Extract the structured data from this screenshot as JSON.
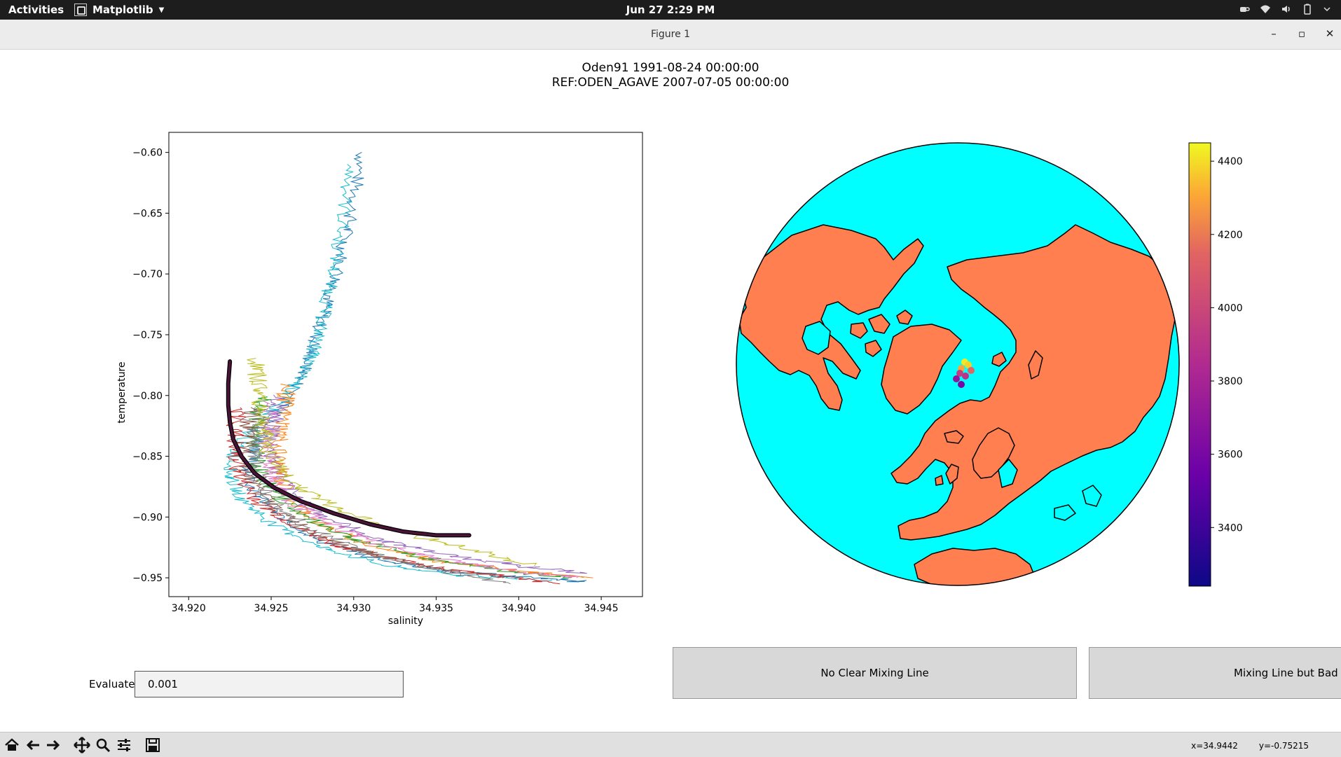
{
  "topbar": {
    "activities": "Activities",
    "app_name": "Matplotlib",
    "clock": "Jun 27  2:29 PM",
    "status_icons": [
      "coffee-icon",
      "wifi-icon",
      "volume-icon",
      "battery-icon",
      "power-menu-icon"
    ]
  },
  "window": {
    "title": "Figure 1",
    "minimize": "–",
    "maximize": "▫",
    "close": "✕"
  },
  "figure": {
    "title_line1": "Oden91 1991-08-24 00:00:00",
    "title_line2": "REF:ODEN_AGAVE 2007-07-05 00:00:00"
  },
  "chart_data": [
    {
      "type": "line",
      "xlabel": "salinity",
      "ylabel": "temperature",
      "xlim": [
        34.9188,
        34.9475
      ],
      "ylim": [
        -0.9655,
        -0.5835
      ],
      "xticks": [
        "34.920",
        "34.925",
        "34.930",
        "34.935",
        "34.940",
        "34.945"
      ],
      "xtick_values": [
        34.92,
        34.925,
        34.93,
        34.935,
        34.94,
        34.945
      ],
      "yticks": [
        "−0.60",
        "−0.65",
        "−0.70",
        "−0.75",
        "−0.80",
        "−0.85",
        "−0.90",
        "−0.95"
      ],
      "ytick_values": [
        -0.6,
        -0.65,
        -0.7,
        -0.75,
        -0.8,
        -0.85,
        -0.9,
        -0.95
      ],
      "grid": false,
      "series": [
        {
          "color": "#1f77b4",
          "x": [
            34.9305,
            34.93,
            34.9295,
            34.929,
            34.9285,
            34.928,
            34.9275,
            34.927,
            34.9262,
            34.9252,
            34.9242,
            34.9236,
            34.924,
            34.9255,
            34.928,
            34.9315,
            34.936,
            34.941,
            34.944
          ],
          "y": [
            -0.6,
            -0.64,
            -0.67,
            -0.7,
            -0.72,
            -0.74,
            -0.76,
            -0.78,
            -0.8,
            -0.82,
            -0.84,
            -0.86,
            -0.88,
            -0.9,
            -0.92,
            -0.935,
            -0.945,
            -0.95,
            -0.953
          ]
        },
        {
          "color": "#17becf",
          "x": [
            34.9298,
            34.9294,
            34.9289,
            34.9284,
            34.928,
            34.9275,
            34.9268,
            34.9256,
            34.924,
            34.9228,
            34.9225,
            34.9232,
            34.925,
            34.928,
            34.932,
            34.9365,
            34.942
          ],
          "y": [
            -0.61,
            -0.65,
            -0.69,
            -0.72,
            -0.745,
            -0.765,
            -0.785,
            -0.805,
            -0.825,
            -0.845,
            -0.865,
            -0.885,
            -0.905,
            -0.925,
            -0.94,
            -0.948,
            -0.952
          ]
        },
        {
          "color": "#ff7f0e",
          "x": [
            34.926,
            34.9258,
            34.9256,
            34.9254,
            34.9256,
            34.9265,
            34.9285,
            34.9315,
            34.9355,
            34.9405,
            34.9445
          ],
          "y": [
            -0.79,
            -0.81,
            -0.83,
            -0.85,
            -0.87,
            -0.89,
            -0.91,
            -0.925,
            -0.937,
            -0.945,
            -0.95
          ]
        },
        {
          "color": "#2ca02c",
          "x": [
            34.9245,
            34.9242,
            34.924,
            34.9242,
            34.9252,
            34.927,
            34.93,
            34.934,
            34.939,
            34.943
          ],
          "y": [
            -0.8,
            -0.82,
            -0.84,
            -0.86,
            -0.88,
            -0.9,
            -0.918,
            -0.933,
            -0.944,
            -0.95
          ]
        },
        {
          "color": "#d62728",
          "x": [
            34.923,
            34.9228,
            34.9228,
            34.9232,
            34.9244,
            34.9265,
            34.9295,
            34.9335,
            34.9385,
            34.9425
          ],
          "y": [
            -0.81,
            -0.83,
            -0.85,
            -0.87,
            -0.89,
            -0.908,
            -0.925,
            -0.938,
            -0.948,
            -0.955
          ]
        },
        {
          "color": "#9467bd",
          "x": [
            34.9255,
            34.9252,
            34.925,
            34.9252,
            34.9262,
            34.9282,
            34.9312,
            34.9352,
            34.94,
            34.944
          ],
          "y": [
            -0.8,
            -0.82,
            -0.84,
            -0.86,
            -0.88,
            -0.9,
            -0.917,
            -0.93,
            -0.94,
            -0.946
          ]
        },
        {
          "color": "#8c564b",
          "x": [
            34.9238,
            34.9236,
            34.9235,
            34.9238,
            34.925,
            34.927,
            34.93,
            34.934,
            34.939
          ],
          "y": [
            -0.81,
            -0.83,
            -0.85,
            -0.87,
            -0.89,
            -0.91,
            -0.926,
            -0.94,
            -0.95
          ]
        },
        {
          "color": "#e377c2",
          "x": [
            34.925,
            34.9248,
            34.9247,
            34.925,
            34.926,
            34.928,
            34.931,
            34.935,
            34.94,
            34.9435
          ],
          "y": [
            -0.805,
            -0.825,
            -0.845,
            -0.865,
            -0.885,
            -0.903,
            -0.92,
            -0.934,
            -0.945,
            -0.95
          ]
        },
        {
          "color": "#7f7f7f",
          "x": [
            34.9243,
            34.9241,
            34.924,
            34.9243,
            34.9254,
            34.9275,
            34.9305,
            34.9345,
            34.9395
          ],
          "y": [
            -0.81,
            -0.83,
            -0.85,
            -0.87,
            -0.89,
            -0.91,
            -0.928,
            -0.942,
            -0.955
          ]
        },
        {
          "color": "#bcbd22",
          "x": [
            34.924,
            34.9242,
            34.9244,
            34.9246,
            34.925,
            34.9262,
            34.9285,
            34.932,
            34.9365,
            34.941
          ],
          "y": [
            -0.77,
            -0.79,
            -0.81,
            -0.83,
            -0.85,
            -0.87,
            -0.89,
            -0.908,
            -0.925,
            -0.94
          ]
        }
      ],
      "mixing_line": {
        "color": "#4a1338",
        "x": [
          34.9225,
          34.9224,
          34.9224,
          34.9225,
          34.9227,
          34.9232,
          34.924,
          34.9252,
          34.9268,
          34.9288,
          34.931,
          34.933,
          34.935,
          34.937
        ],
        "y": [
          -0.772,
          -0.79,
          -0.808,
          -0.822,
          -0.836,
          -0.85,
          -0.864,
          -0.876,
          -0.887,
          -0.897,
          -0.906,
          -0.912,
          -0.915,
          -0.915
        ]
      }
    },
    {
      "type": "scatter",
      "map": "north-polar orthographic",
      "land_color": "#ff7f50",
      "ocean_color": "#00ffff",
      "colorbar": {
        "cmap": "plasma",
        "ticks": [
          "3400",
          "3600",
          "3800",
          "4000",
          "4200",
          "4400"
        ],
        "tick_values": [
          3400,
          3600,
          3800,
          4000,
          4200,
          4400
        ],
        "range": [
          3240,
          4450
        ]
      },
      "points": [
        {
          "value": 4420
        },
        {
          "value": 4380
        },
        {
          "value": 4300
        },
        {
          "value": 4150
        },
        {
          "value": 3950
        },
        {
          "value": 3700
        },
        {
          "value": 3900
        },
        {
          "value": 3600
        }
      ]
    }
  ],
  "widgets": {
    "evaluate_label": "Evaluate",
    "evaluate_value": "0.001",
    "btn_no_clear": "No Clear Mixing Line",
    "btn_bad_ref": "Mixing Line but Bad R"
  },
  "toolbar": {
    "icons": [
      "home-icon",
      "back-icon",
      "forward-icon",
      "pan-icon",
      "zoom-icon",
      "configure-subplots-icon",
      "save-icon"
    ],
    "x_readout": "x=34.9442",
    "y_readout": "y=-0.75215"
  }
}
